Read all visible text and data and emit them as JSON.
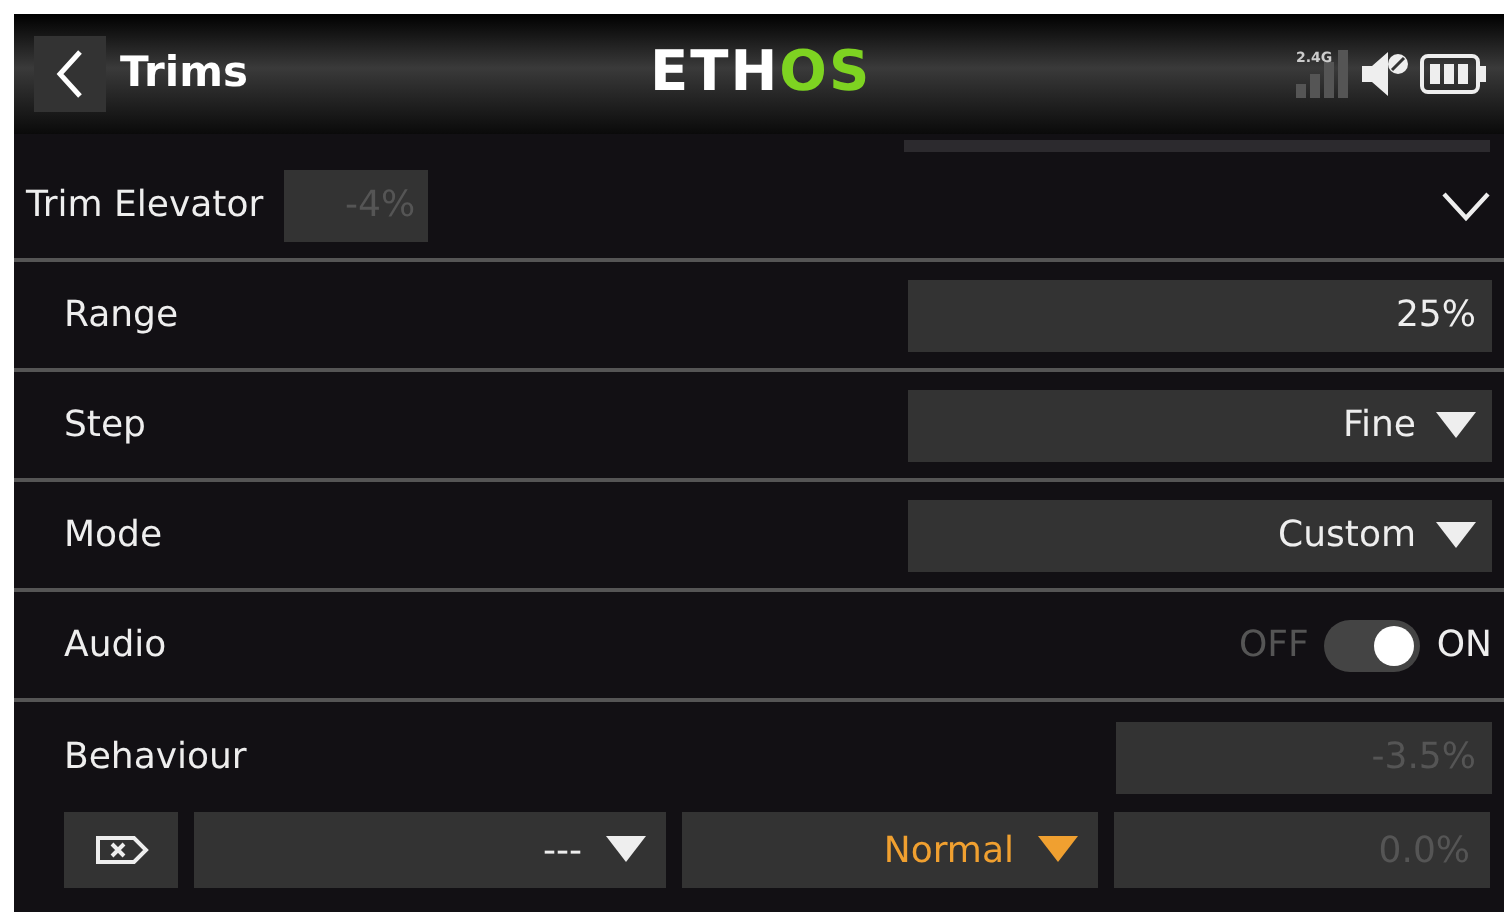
{
  "header": {
    "title": "Trims",
    "logo": {
      "main": "ETH",
      "accent": "OS"
    },
    "radio_band": "2.4G"
  },
  "section": {
    "label": "Trim Elevator",
    "value": "-4%",
    "value_disabled": true,
    "expanded": true
  },
  "rows": [
    {
      "kind": "field",
      "label": "Range",
      "value": "25%"
    },
    {
      "kind": "dropdown",
      "label": "Step",
      "value": "Fine"
    },
    {
      "kind": "dropdown",
      "label": "Mode",
      "value": "Custom"
    },
    {
      "kind": "toggle",
      "label": "Audio",
      "off_label": "OFF",
      "on_label": "ON",
      "on": true
    },
    {
      "kind": "field",
      "label": "Behaviour",
      "value": "-3.5%",
      "disabled": true
    }
  ],
  "behaviour_line": {
    "source": "---",
    "mode": "Normal",
    "value": "0.0%"
  }
}
